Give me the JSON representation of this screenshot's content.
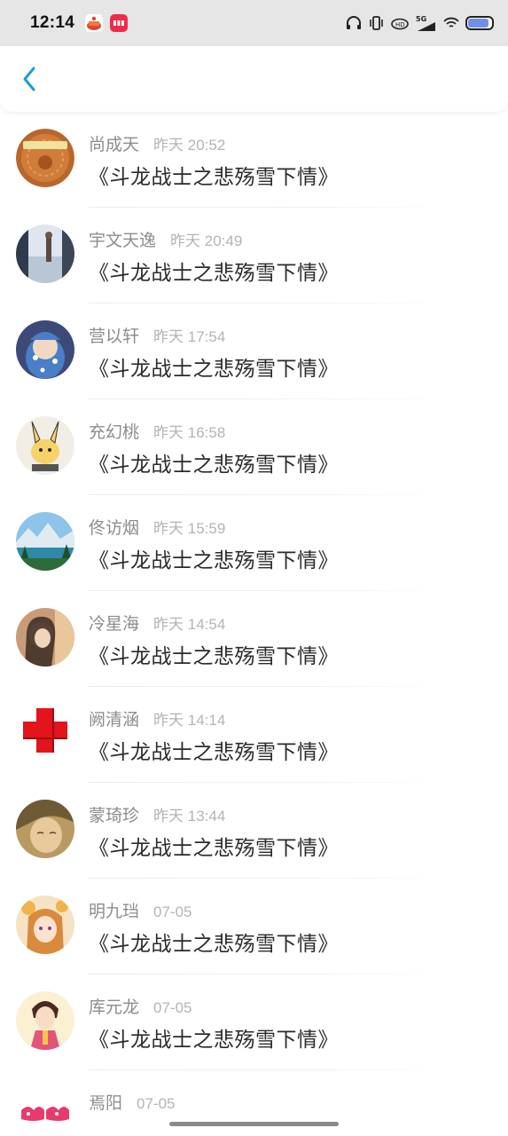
{
  "status_bar": {
    "time": "12:14",
    "icons": [
      "cake-app-icon",
      "shop-app-icon",
      "headphones-icon",
      "vibrate-icon",
      "hd-icon",
      "signal-5g-icon",
      "wifi-icon",
      "battery-icon"
    ],
    "battery_fraction": 0.9
  },
  "header": {
    "back_icon": "chevron-left-icon",
    "accent": "#1e9bd9"
  },
  "contacts": [
    {
      "name": "尚成天",
      "time": "昨天 20:52",
      "message": "《斗龙战士之悲殇雪下情》"
    },
    {
      "name": "宇文天逸",
      "time": "昨天 20:49",
      "message": "《斗龙战士之悲殇雪下情》"
    },
    {
      "name": "营以轩",
      "time": "昨天 17:54",
      "message": "《斗龙战士之悲殇雪下情》"
    },
    {
      "name": "充幻桃",
      "time": "昨天 16:58",
      "message": "《斗龙战士之悲殇雪下情》"
    },
    {
      "name": "佟访烟",
      "time": "昨天 15:59",
      "message": "《斗龙战士之悲殇雪下情》"
    },
    {
      "name": "冷星海",
      "time": "昨天 14:54",
      "message": "《斗龙战士之悲殇雪下情》"
    },
    {
      "name": "阙清涵",
      "time": "昨天 14:14",
      "message": "《斗龙战士之悲殇雪下情》"
    },
    {
      "name": "蒙琦珍",
      "time": "昨天 13:44",
      "message": "《斗龙战士之悲殇雪下情》"
    },
    {
      "name": "明九珰",
      "time": "07-05",
      "message": "《斗龙战士之悲殇雪下情》"
    },
    {
      "name": "库元龙",
      "time": "07-05",
      "message": "《斗龙战士之悲殇雪下情》"
    },
    {
      "name": "焉阳",
      "time": "07-05",
      "message": ""
    }
  ]
}
